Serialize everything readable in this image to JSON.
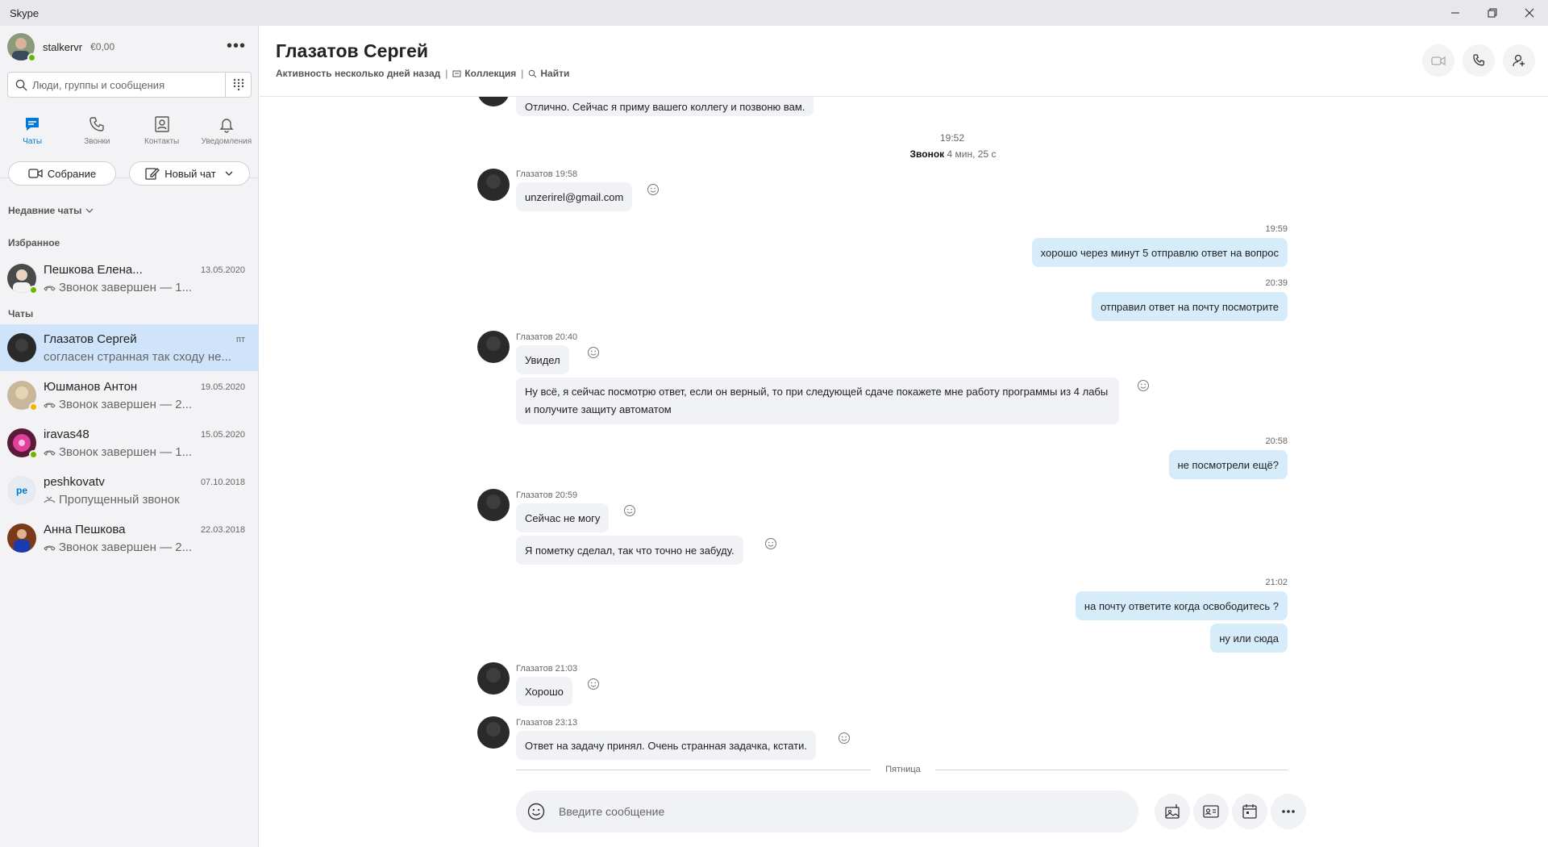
{
  "window": {
    "title": "Skype"
  },
  "profile": {
    "username": "stalkervr",
    "balance": "€0,00"
  },
  "search": {
    "placeholder": "Люди, группы и сообщения"
  },
  "nav": [
    {
      "label": "Чаты"
    },
    {
      "label": "Звонки"
    },
    {
      "label": "Контакты"
    },
    {
      "label": "Уведомления"
    }
  ],
  "actions": {
    "meeting": "Собрание",
    "new_chat": "Новый чат"
  },
  "sections": {
    "recent": "Недавние чаты",
    "favorites": "Избранное",
    "chats": "Чаты"
  },
  "favorites": [
    {
      "name": "Пешкова Елена...",
      "date": "13.05.2020",
      "preview": "Звонок завершен — 1..."
    }
  ],
  "chats": [
    {
      "name": "Глазатов Сергей",
      "date": "пт",
      "preview": "согласен странная так сходу не..."
    },
    {
      "name": "Юшманов Антон",
      "date": "19.05.2020",
      "preview": "Звонок завершен — 2..."
    },
    {
      "name": "iravas48",
      "date": "15.05.2020",
      "preview": "Звонок завершен — 1..."
    },
    {
      "name": "peshkovatv",
      "initials": "pe",
      "date": "07.10.2018",
      "preview": "Пропущенный звонок"
    },
    {
      "name": "Анна Пешкова",
      "date": "22.03.2018",
      "preview": "Звонок завершен — 2..."
    }
  ],
  "conversation": {
    "contact_name": "Глазатов Сергей",
    "activity": "Активность несколько дней назад",
    "collection": "Коллекция",
    "find": "Найти",
    "call_time": "19:52",
    "call_label": "Звонок",
    "call_duration": "4 мин, 25 с",
    "day_divider": "Пятница",
    "messages": [
      {
        "text": "Отлично. Сейчас я приму вашего коллегу и позвоню вам."
      },
      {
        "sender": "Глазатов 19:58",
        "text": "unzerirel@gmail.com"
      },
      {
        "time": "19:59",
        "text": "хорошо через минут 5 отправлю ответ на вопрос"
      },
      {
        "time": "20:39",
        "text": "отправил ответ на почту посмотрите"
      },
      {
        "sender": "Глазатов 20:40",
        "text": "Увидел"
      },
      {
        "text": "Ну всё, я сейчас посмотрю ответ, если он верный, то при следующей сдаче покажете мне работу программы из 4 лабы и получите защиту автоматом"
      },
      {
        "time": "20:58",
        "text": "не посмотрели ещё?"
      },
      {
        "sender": "Глазатов 20:59",
        "text": "Сейчас не могу"
      },
      {
        "text": "Я пометку сделал, так что точно не забуду."
      },
      {
        "time": "21:02",
        "text": "на почту ответите когда освободитесь ?"
      },
      {
        "text": "ну или сюда"
      },
      {
        "sender": "Глазатов 21:03",
        "text": "Хорошо"
      },
      {
        "sender": "Глазатов 23:13",
        "text": "Ответ на задачу принял. Очень странная задачка, кстати."
      }
    ]
  },
  "composer": {
    "placeholder": "Введите сообщение"
  },
  "colors": {
    "accent": "#0078d4",
    "active_chat": "#cfe4fa",
    "outgoing_bubble": "#d6ecfb",
    "incoming_bubble": "#f1f2f5",
    "online": "#6bb700"
  }
}
